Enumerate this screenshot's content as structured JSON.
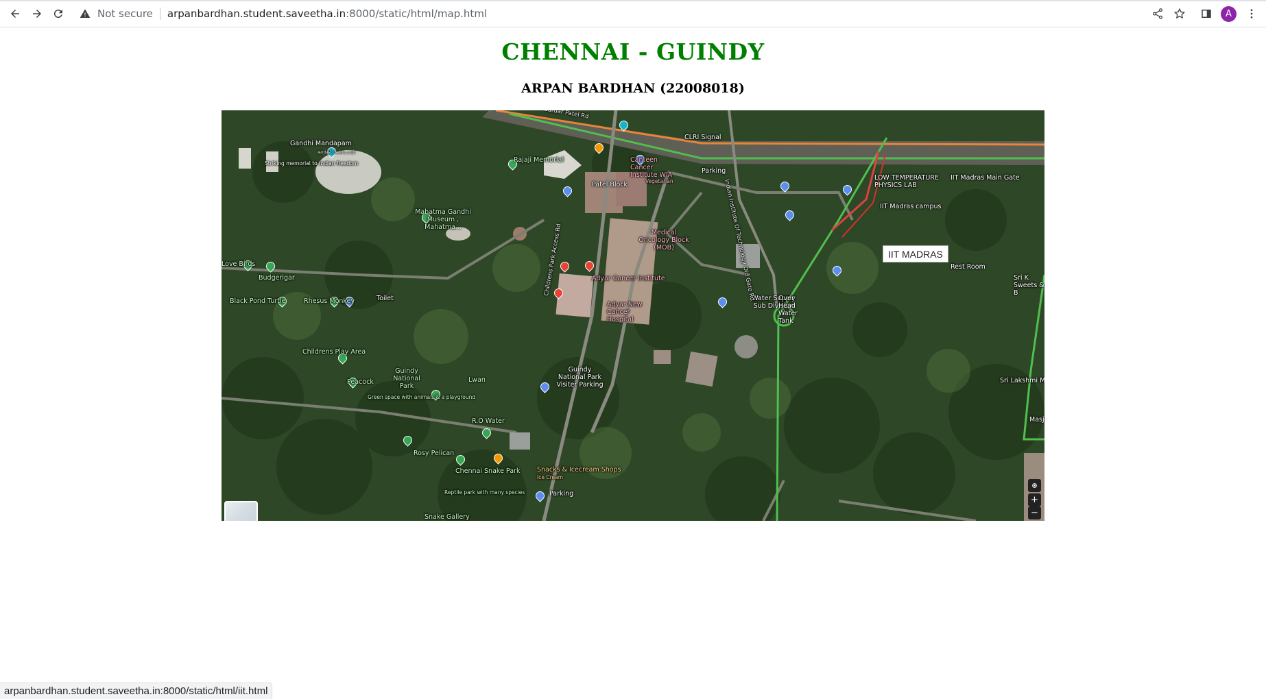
{
  "browser": {
    "security_label": "Not secure",
    "url_host": "arpanbardhan.student.saveetha.in",
    "url_path": ":8000/static/html/map.html",
    "avatar_initial": "A",
    "status_url": "arpanbardhan.student.saveetha.in:8000/static/html/iit.html",
    "icons": [
      "back-icon",
      "forward-icon",
      "reload-icon",
      "warning-icon",
      "share-icon",
      "star-icon",
      "sidepanel-icon",
      "kebab-menu-icon"
    ]
  },
  "page": {
    "title": "CHENNAI - GUINDY",
    "subtitle": "ARPAN BARDHAN (22008018)",
    "title_color": "#008000"
  },
  "map": {
    "hotspot_label": "IIT MADRAS",
    "labels": {
      "gandhi_mandapam": "Gandhi Mandapam",
      "gandhi_mandapam_ta": "காந்தி மண்டபம்",
      "gandhi_mandapam_desc": "Striking memorial to Indian freedom",
      "rajaji_memorial": "Rajaji Memorial",
      "mahatma_museum": "Mahatma Gandhi Museum , Mahatma...",
      "sardar_patel_rd": "Sardar Patel Rd",
      "clri_signal": "CLRI Signal",
      "canteen": "Canteen Cancer Institute WIA",
      "canteen_desc": "Vegetarian",
      "parking_top": "Parking",
      "patel_block": "Patel Block",
      "low_temp_lab": "LOW TEMPERATURE PHYSICS LAB",
      "iit_main_gate": "IIT Madras Main Gate",
      "iit_campus": "IIT Madras campus",
      "medical_oncology": "Medical Oncology Block (MOB)",
      "adyar_cancer": "Adyar Cancer Institute",
      "adyar_hospital": "Adyar New Cancer Hospital",
      "rest_room": "Rest Room",
      "sweets": "Sri K Sweets & B",
      "love_birds": "Love Birds",
      "budgerigar": "Budgerigar",
      "black_pond_turtle": "Black Pond Turtle",
      "rhesus_monkey": "Rhesus Monkey",
      "toilet": "Toilet",
      "childrens_park_rd": "Childrens Park Access Rd",
      "water_supply": "Water Supply Sub Division",
      "overhead_tank": "Over Head Water Tank",
      "old_gate_rd": "Indian Institute Of Technology Old Gate Rd",
      "childrens_play": "Childrens Play Area",
      "guindy_np": "Guindy National Park",
      "peacock": "Peacock",
      "green_space": "Green space with animals & a playground",
      "lwan": "Lwan",
      "np_parking": "Guindy National Park Visiter Parking",
      "sri_lakshmi": "Sri Lakshmi Me",
      "ro_water": "R.O Water",
      "rosy_pelican": "Rosy Pelican",
      "snacks": "Snacks & Icecream Shops",
      "ice_cream": "Ice Cream",
      "snake_park": "Chennai Snake Park",
      "snake_park_desc": "Reptile park with many species",
      "parking_bottom": "Parking",
      "snake_gallery": "Snake Gallery",
      "masj": "Masj"
    },
    "controls": {
      "zoom_in": "+",
      "zoom_out": "−"
    }
  }
}
